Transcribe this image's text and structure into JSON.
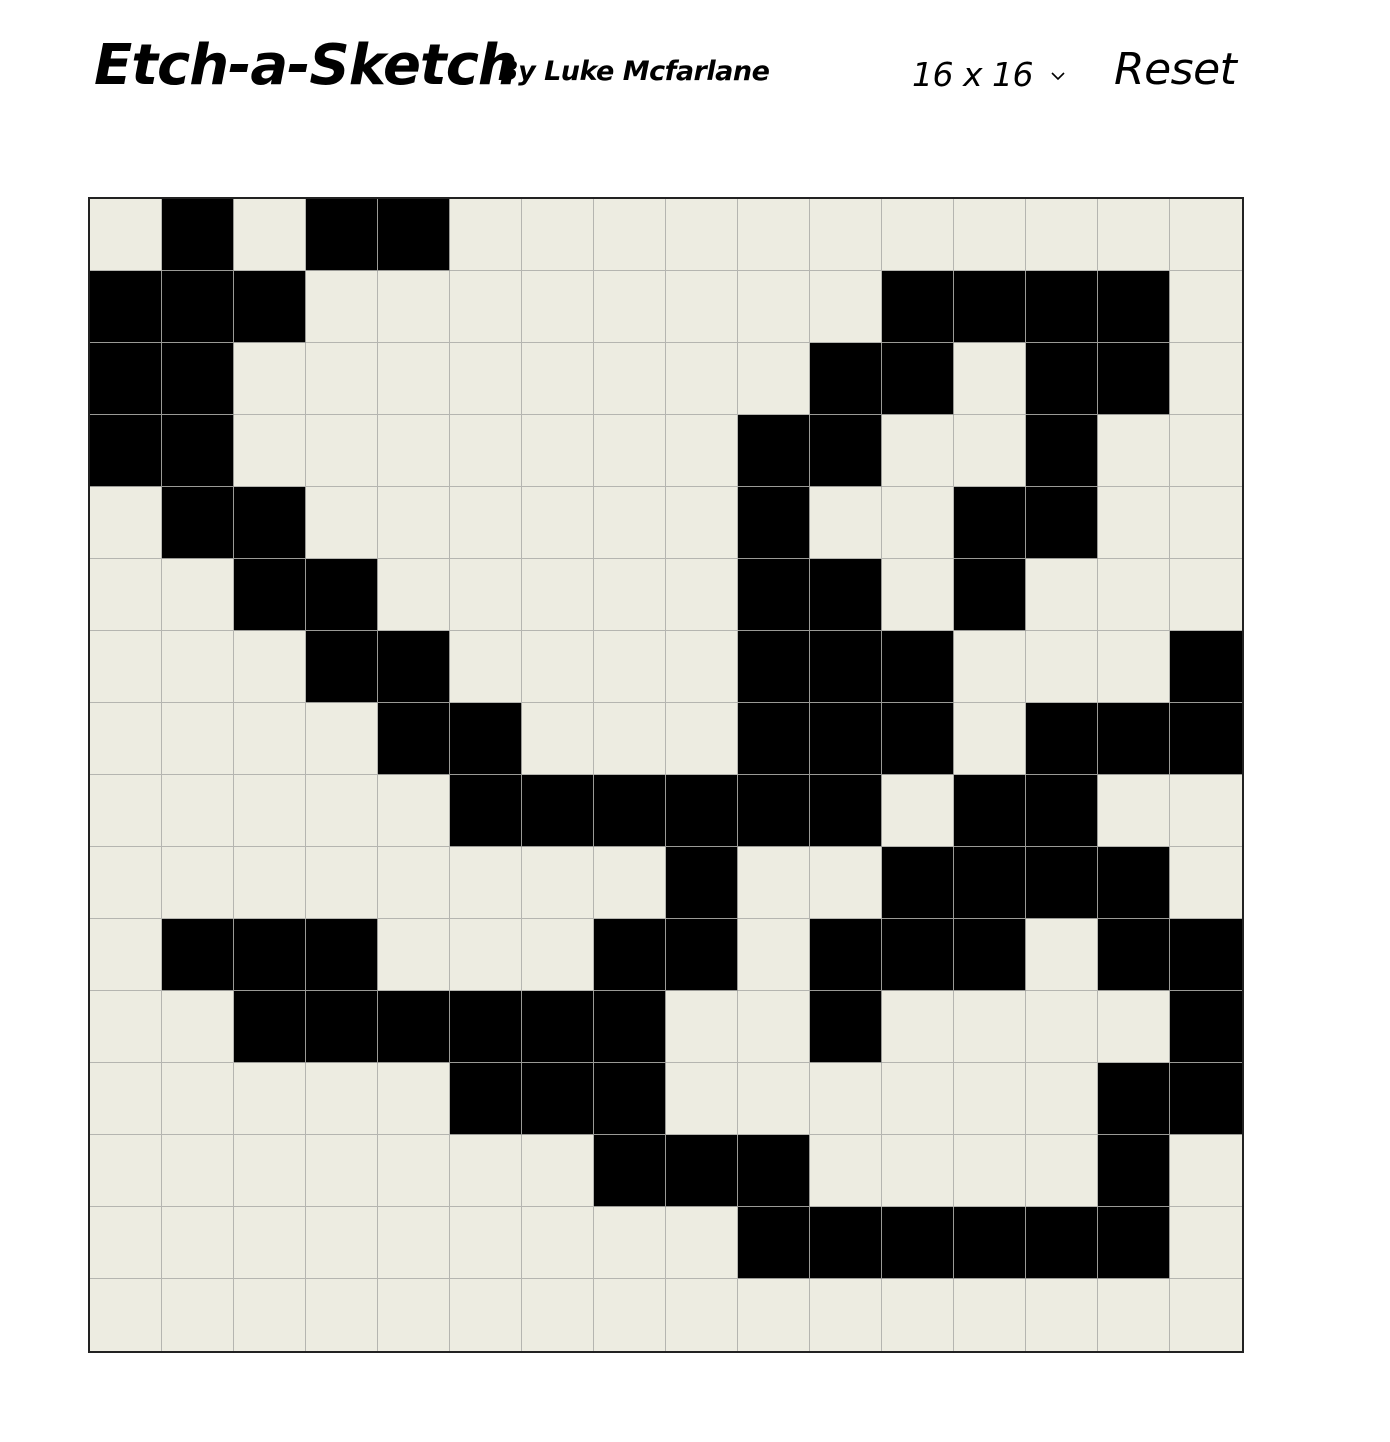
{
  "header": {
    "title": "Etch-a-Sketch",
    "author": "By Luke Mcfarlane",
    "size_select": {
      "value": "16 x 16",
      "icon": "chevron-down-icon"
    },
    "reset_label": "Reset"
  },
  "grid": {
    "rows": 16,
    "cols": 16,
    "ink_color": "#000000",
    "paper_color": "#edece1",
    "line_color": "#b5b5b0",
    "cells": [
      "0101100000000000",
      "1110000000011110",
      "1100000000110110",
      "1100000001100100",
      "0110000001001100",
      "0011000001101000",
      "0001100001110001",
      "0000110001110111",
      "0000011111101100",
      "0000000010011110",
      "0111000110111011",
      "0011111100100001",
      "0000011100000011",
      "0000000111000010",
      "0000000001111110",
      "0000000000000000"
    ]
  }
}
